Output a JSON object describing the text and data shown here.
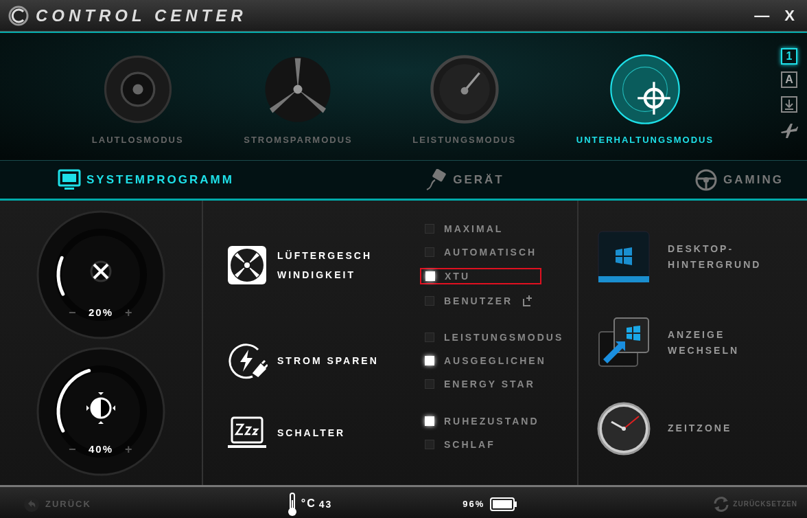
{
  "window": {
    "title": "CONTROL CENTER",
    "minimize": "—",
    "close": "X"
  },
  "modes": [
    {
      "kind": "silent",
      "label": "LAUTLOSMODUS",
      "selected": false
    },
    {
      "kind": "power_saving",
      "label": "STROMSPARMODUS",
      "selected": false
    },
    {
      "kind": "performance",
      "label": "LEISTUNGSMODUS",
      "selected": false
    },
    {
      "kind": "entertainment",
      "label": "UNTERHALTUNGSMODUS",
      "selected": true
    }
  ],
  "side_buttons": [
    {
      "kind": "text",
      "label": "1",
      "selected": true
    },
    {
      "kind": "text",
      "label": "A",
      "selected": false
    },
    {
      "kind": "download",
      "selected": false
    },
    {
      "kind": "airplane",
      "selected": false
    }
  ],
  "tabs": [
    {
      "kind": "monitor",
      "label": "SYSTEMPROGRAMM",
      "selected": true
    },
    {
      "kind": "plug",
      "label": "GERÄT",
      "selected": false
    },
    {
      "kind": "wheel",
      "label": "GAMING",
      "selected": false
    }
  ],
  "dials": [
    {
      "kind": "fan",
      "level": 0.2,
      "reading": "20%",
      "minus": "−",
      "plus": "+"
    },
    {
      "kind": "brightness",
      "level": 0.4,
      "reading": "40%",
      "minus": "−",
      "plus": "+"
    }
  ],
  "sections": [
    {
      "kind": "fan",
      "label_lines": [
        "LÜFTERGESCH",
        "WINDIGKEIT"
      ],
      "options": [
        {
          "label": "MAXIMAL",
          "checked": false,
          "highlighted": false,
          "add_icon": false
        },
        {
          "label": "AUTOMATISCH",
          "checked": false,
          "highlighted": false,
          "add_icon": false
        },
        {
          "label": "XTU",
          "checked": true,
          "highlighted": true,
          "add_icon": false
        },
        {
          "label": "BENUTZER",
          "checked": false,
          "highlighted": false,
          "add_icon": true
        }
      ]
    },
    {
      "kind": "power",
      "label_lines": [
        "STROM SPAREN"
      ],
      "options": [
        {
          "label": "LEISTUNGSMODUS",
          "checked": false,
          "highlighted": false,
          "add_icon": false
        },
        {
          "label": "AUSGEGLICHEN",
          "checked": true,
          "highlighted": false,
          "add_icon": false
        },
        {
          "label": "ENERGY STAR",
          "checked": false,
          "highlighted": false,
          "add_icon": false
        }
      ]
    },
    {
      "kind": "sleep",
      "label_lines": [
        "SCHALTER"
      ],
      "options": [
        {
          "label": "RUHEZUSTAND",
          "checked": true,
          "highlighted": false,
          "add_icon": false
        },
        {
          "label": "SCHLAF",
          "checked": false,
          "highlighted": false,
          "add_icon": false
        }
      ]
    }
  ],
  "shortcuts": [
    {
      "kind": "wallpaper",
      "label_lines": [
        "DESKTOP-",
        "HINTERGRUND"
      ]
    },
    {
      "kind": "display",
      "label_lines": [
        "ANZEIGE",
        "WECHSELN"
      ]
    },
    {
      "kind": "clock",
      "label_lines": [
        "ZEITZONE"
      ]
    }
  ],
  "status_bar": {
    "back": "ZURÜCK",
    "temperature_unit": "°C",
    "temperature": "43",
    "battery": "96%",
    "reset": "ZURÜCKSETZEN"
  }
}
